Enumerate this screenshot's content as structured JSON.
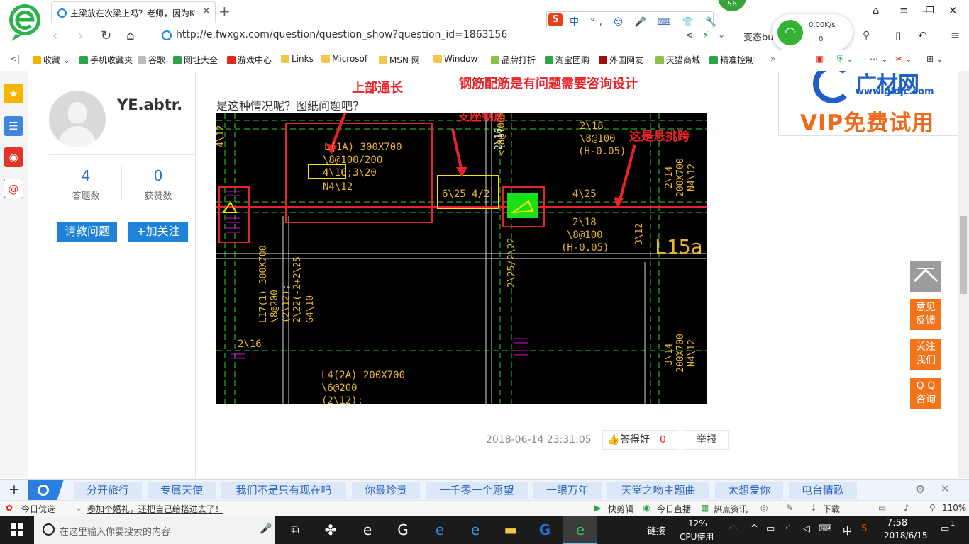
{
  "browser": {
    "tab_title": "主梁放在次梁上吗？老师，因为K",
    "ime_text": "中 °, ☺ 🎤 ⌨ 👕 🔧",
    "ime_logo": "S",
    "badge": "56",
    "url": "http://e.fwxgx.com/question/question_show?question_id=1863156",
    "addr_right": "变态bu",
    "net_rate": "0.00K/s",
    "net_count": "0"
  },
  "bookmarks": [
    {
      "label": "收藏",
      "color": "#f2b400"
    },
    {
      "label": "手机收藏夹",
      "color": "#2ea34a"
    },
    {
      "label": "谷歌",
      "color": "#bbbbbb"
    },
    {
      "label": "网址大全",
      "color": "#2ea34a"
    },
    {
      "label": "游戏中心",
      "color": "#e02a1a"
    },
    {
      "label": "Links",
      "color": "#f2c84b"
    },
    {
      "label": "Microsof",
      "color": "#f2c84b"
    },
    {
      "label": "MSN 网",
      "color": "#f2c84b"
    },
    {
      "label": "Window",
      "color": "#f2c84b"
    },
    {
      "label": "品牌打折",
      "color": "#8bc34a"
    },
    {
      "label": "淘宝团购",
      "color": "#2ea34a"
    },
    {
      "label": "外国网友",
      "color": "#a01010"
    },
    {
      "label": "天猫商城",
      "color": "#8bc34a"
    },
    {
      "label": "精准控制",
      "color": "#2ea34a"
    }
  ],
  "user": {
    "name": "YE.abtr.",
    "answers_count": "4",
    "answers_label": "答题数",
    "likes_count": "0",
    "likes_label": "获赞数",
    "ask_button": "请教问题",
    "follow_button": "+加关注"
  },
  "question": {
    "text": "是这种情况呢？图纸问题吧？"
  },
  "drawing": {
    "annot_top": "上部通长",
    "annot_design": "钢筋配筋是有问题需要咨询设计",
    "annot_support": "支座钢筋",
    "annot_cantilever": "这是悬挑跨",
    "beam1": "L(1A) 300X700",
    "beam1_b": "\\8@100/200",
    "beam1_c": "4\\16;3\\20",
    "beam1_d": "N4\\12",
    "support_rebar": "6\\25 4/2",
    "rebar_425": "4\\25",
    "rebar_218a": "2\\18",
    "rebar_8100a": "\\8@100",
    "h005a": "(H-0.05)",
    "rebar_218b": "2\\18",
    "rebar_8100b": "\\8@100",
    "h005b": "(H-0.05)",
    "rebar_216": "2\\16",
    "rebar_816": "<\\8@100>",
    "l15": "L15a",
    "beam_l4": "L4(2A) 200X700",
    "beam_l4_b": "\\6@200",
    "beam_l4_c": "(2\\12);",
    "beam_l17": "L17(1) 300X700",
    "beam_l17_b": "\\8@200",
    "beam_l17_c": "(2\\12);",
    "beam_l17_d": "2\\22(-2+2\\25",
    "beam_l17_e": "G4\\10",
    "v2252": "2\\25/2\\22",
    "r312": "3\\12",
    "r214": "2\\14",
    "r200": "200X700",
    "rn4": "N4\\12",
    "r314": "3\\14",
    "r200b": "200X700",
    "rn4b": "N4\\12",
    "r216b": "2\\16",
    "r412": "4\\12"
  },
  "answer": {
    "time": "2018-06-14 23:31:05",
    "good_label": "答得好",
    "good_count": "0",
    "report_label": "举报"
  },
  "ad": {
    "brand": "广材网",
    "url": "www.gldjc.com",
    "vip": "VIP免费试用"
  },
  "float_buttons": [
    "意见\n反馈",
    "关注\n我们",
    "Q Q\n咨询"
  ],
  "hot_words": [
    "分开旅行",
    "专属天使",
    "我们不是只有现在吗",
    "你最珍贵",
    "一千零一个愿望",
    "一眼万年",
    "天堂之吻主题曲",
    "太想爱你",
    "电台情歌"
  ],
  "status": {
    "today_pick": "今日优选",
    "headline": "参加个婚礼，还把自己给搭进去了！",
    "quick_cut": "快剪辑",
    "live": "今日直播",
    "news": "热点资讯",
    "download": "下载",
    "zoom": "110%"
  },
  "taskbar": {
    "search_placeholder": "在这里输入你要搜索的内容",
    "link_label": "链接",
    "cpu_percent": "12%",
    "cpu_label": "CPU使用",
    "ime": "中",
    "time": "7:58",
    "date": "2018/6/15",
    "notif": "1"
  }
}
